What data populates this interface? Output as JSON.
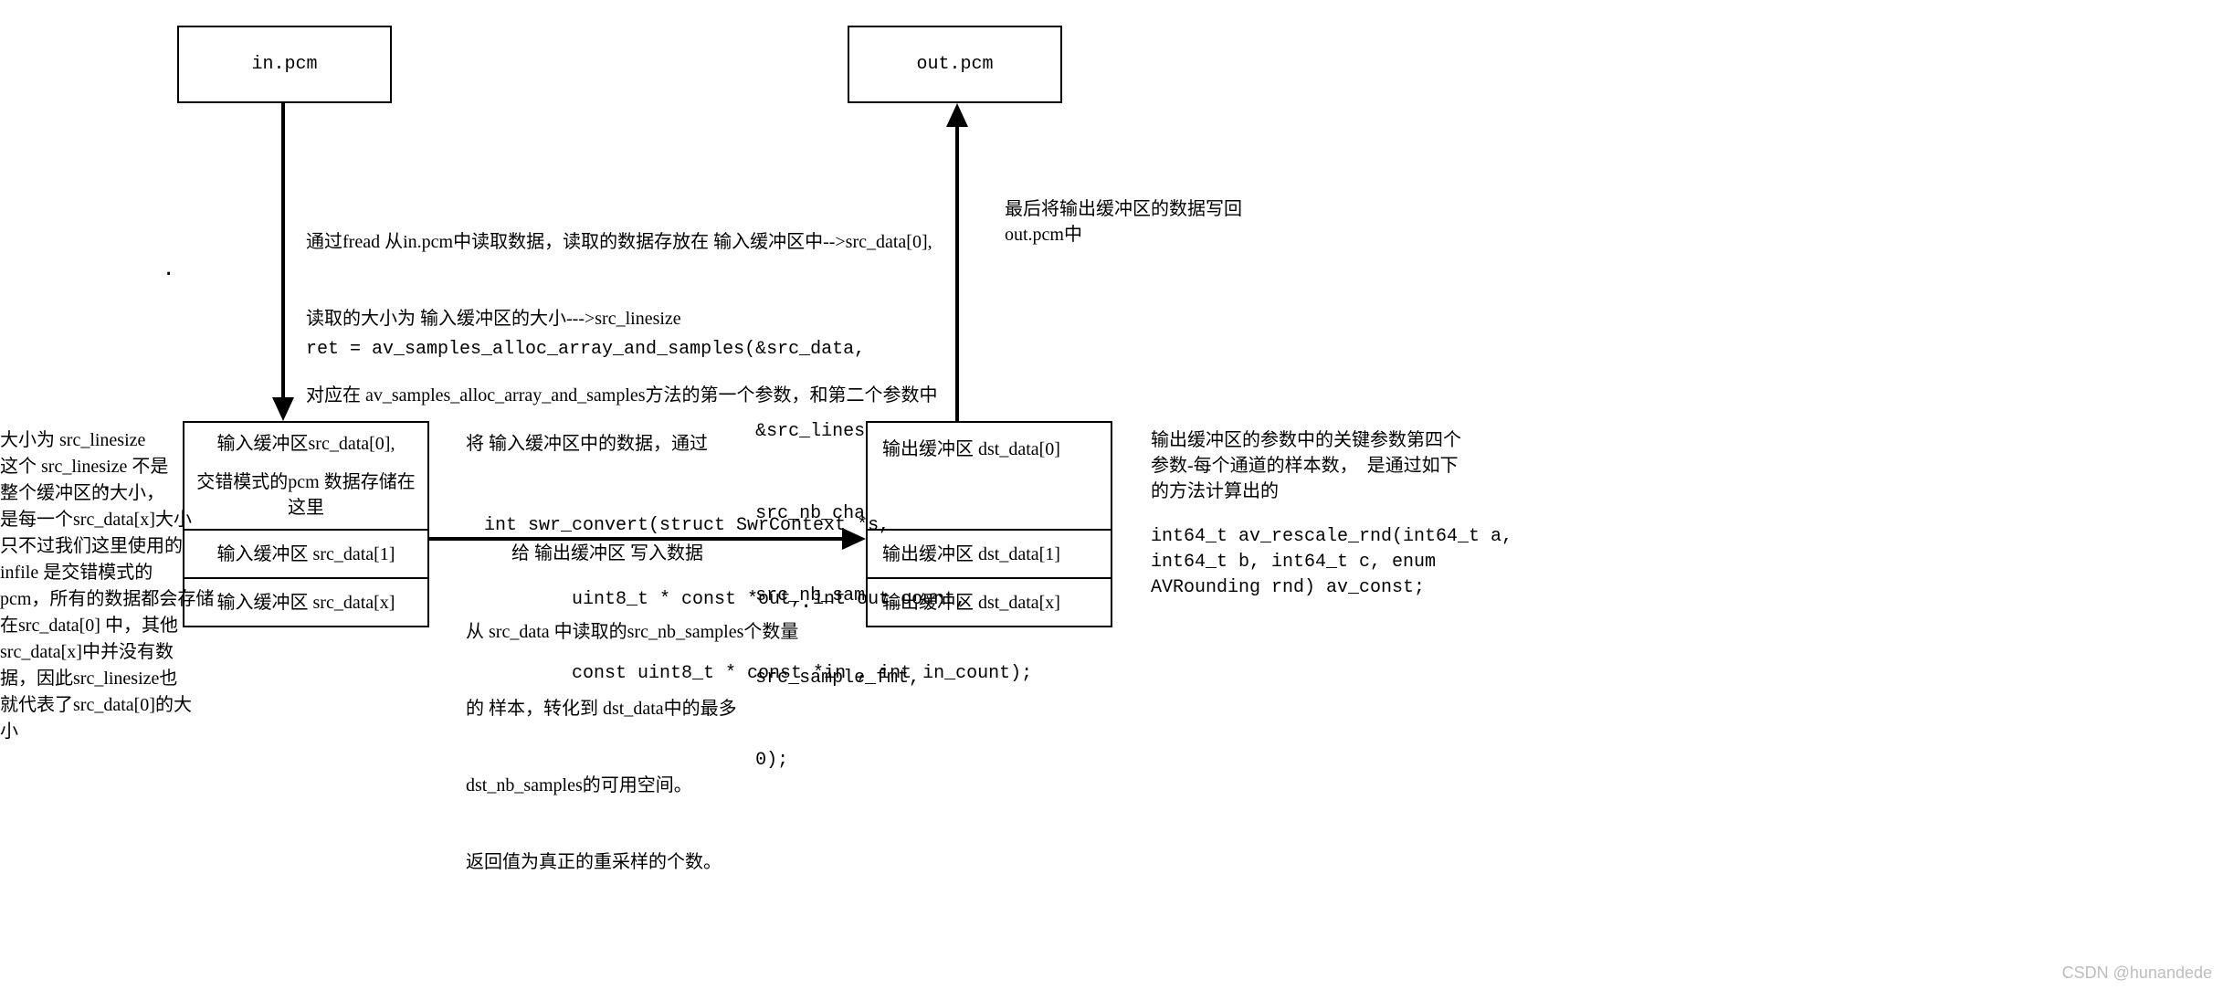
{
  "nodes": {
    "in_pcm": "in.pcm",
    "out_pcm": "out.pcm",
    "src0_line1": "输入缓冲区src_data[0],",
    "src0_line2": "交错模式的pcm 数据存储在这里",
    "src1": "输入缓冲区 src_data[1]",
    "srcx": "输入缓冲区 src_data[x]",
    "dst0": "输出缓冲区 dst_data[0]",
    "dst1": "输出缓冲区 dst_data[1]",
    "dstx": "输出缓冲区 dst_data[x]"
  },
  "left_note": "大小为 src_linesize\n这个 src_linesize 不是\n整个缓冲区的大小，\n是每一个src_data[x]大小\n只不过我们这里使用的\ninfile 是交错模式的\npcm，所有的数据都会存储\n在src_data[0] 中，其他\nsrc_data[x]中并没有数\n据，因此src_linesize也\n就代表了src_data[0]的大\n小",
  "top_paragraph": {
    "l1": "通过fread 从in.pcm中读取数据，读取的数据存放在 输入缓冲区中-->src_data[0],",
    "l2": "读取的大小为 输入缓冲区的大小--->src_linesize",
    "l3": "对应在 av_samples_alloc_array_and_samples方法的第一个参数，和第二个参数中",
    "code1": "ret = av_samples_alloc_array_and_samples(&src_data,",
    "code2": "                                         &src_linesize,",
    "code3": "                                         src_nb_channels,",
    "code4": "                                         src_nb_samples,",
    "code5": "                                         src_sample_fmt,",
    "code6": "                                         0);"
  },
  "middle": {
    "l1": "将 输入缓冲区中的数据，通过",
    "c1": "int swr_convert(struct SwrContext *s,",
    "c2": "        uint8_t * const *out, int out_count,",
    "c3": "        const uint8_t * const *in , int in_count);",
    "l2": "给 输出缓冲区 写入数据",
    "l3": "从 src_data 中读取的src_nb_samples个数量",
    "l4": "的 样本，转化到 dst_data中的最多",
    "l5": "dst_nb_samples的可用空间。",
    "l6": "返回值为真正的重采样的个数。"
  },
  "right_note_top": "最后将输出缓冲区的数据写回\nout.pcm中",
  "right_note_bottom": {
    "p1": "输出缓冲区的参数中的关键参数第四个\n参数-每个通道的样本数，  是通过如下\n的方法计算出的",
    "c1": "int64_t av_rescale_rnd(int64_t a,\nint64_t b, int64_t c, enum\nAVRounding rnd) av_const;"
  },
  "watermark": "CSDN @hunandede"
}
